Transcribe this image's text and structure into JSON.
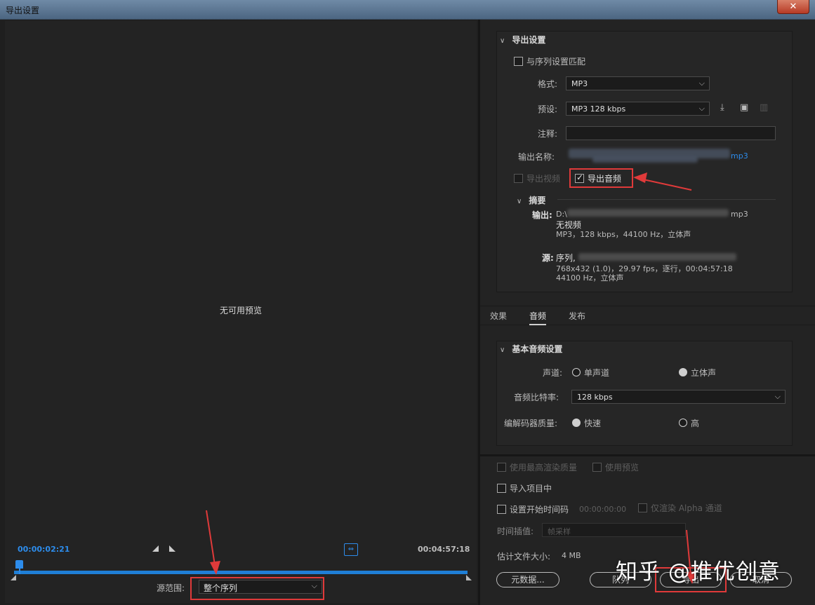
{
  "window": {
    "title": "导出设置",
    "close_glyph": "✕"
  },
  "preview": {
    "no_preview": "无可用预览",
    "timecode_current": "00:00:02:21",
    "timecode_duration": "00:04:57:18",
    "source_range_label": "源范围:",
    "source_range_value": "整个序列"
  },
  "export_settings": {
    "header": "导出设置",
    "match_sequence": "与序列设置匹配",
    "format_label": "格式:",
    "format_value": "MP3",
    "preset_label": "预设:",
    "preset_value": "MP3 128 kbps",
    "comments_label": "注释:",
    "comments_value": "",
    "output_name_label": "输出名称:",
    "output_name_suffix": "mp3",
    "export_video": "导出视频",
    "export_audio": "导出音频",
    "export_video_checked": false,
    "export_audio_checked": true,
    "summary": {
      "header": "摘要",
      "output_label": "输出:",
      "output_path_prefix": "D:\\",
      "output_path_suffix": "mp3",
      "output_line2": "无视频",
      "output_line3": "MP3，128 kbps，44100 Hz，立体声",
      "source_label": "源:",
      "source_line1": "序列,",
      "source_line2": "768x432 (1.0)，29.97 fps，逐行，00:04:57:18",
      "source_line3": "44100 Hz，立体声"
    }
  },
  "tabs": [
    {
      "label": "效果",
      "active": false
    },
    {
      "label": "音频",
      "active": true
    },
    {
      "label": "发布",
      "active": false
    }
  ],
  "audio": {
    "header": "基本音频设置",
    "channels_label": "声道:",
    "channel_mono": "单声道",
    "channel_stereo": "立体声",
    "channel_selected": "立体声",
    "bitrate_label": "音频比特率:",
    "bitrate_value": "128 kbps",
    "codec_quality_label": "编解码器质量:",
    "quality_fast": "快速",
    "quality_high": "高",
    "quality_selected": "快速"
  },
  "bottom": {
    "max_render_quality": "使用最高渲染质量",
    "use_previews": "使用预览",
    "import_into_project": "导入项目中",
    "set_start_timecode": "设置开始时间码",
    "start_timecode_value": "00:00:00:00",
    "render_alpha_only": "仅渲染 Alpha 通道",
    "time_interpolation_label": "时间插值:",
    "time_interpolation_value": "帧采样",
    "estimated_size_label": "估计文件大小:",
    "estimated_size_value": "4 MB",
    "metadata_button": "元数据...",
    "queue_button": "队列",
    "export_button": "导出",
    "cancel_button": "取消"
  },
  "watermark": "知乎 @推优创意",
  "colors": {
    "accent": "#2d8ceb",
    "annotation": "#e03a3a"
  }
}
